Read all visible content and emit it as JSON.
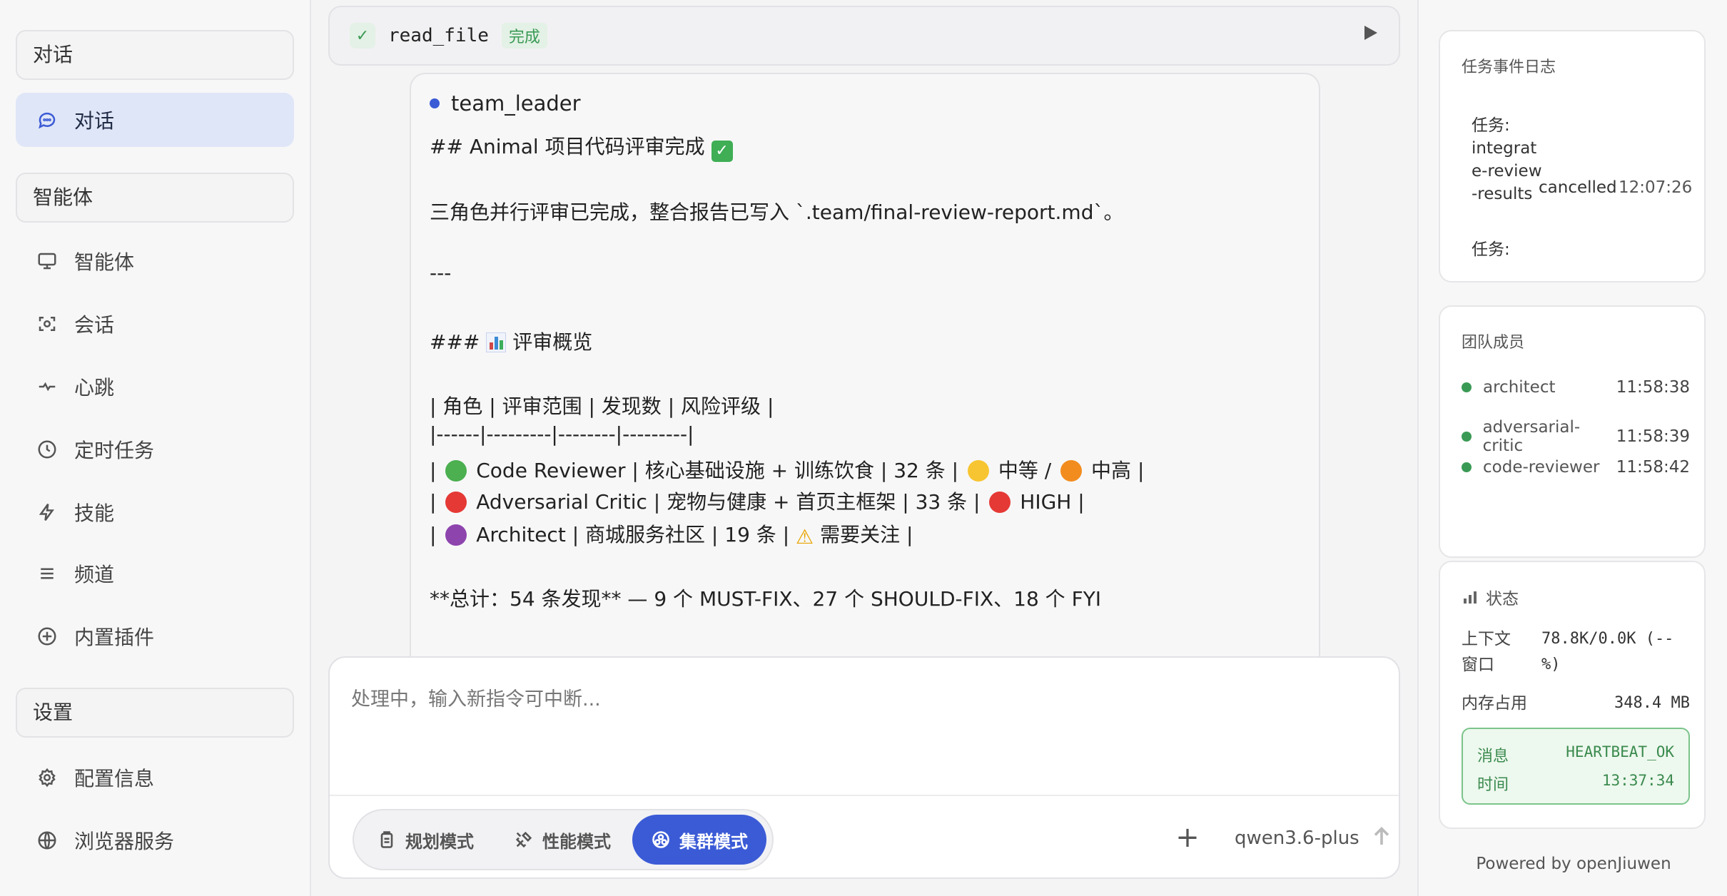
{
  "sidebar": {
    "section_chat": "对话",
    "item_chat": "对话",
    "section_agents": "智能体",
    "items": [
      {
        "label": "智能体",
        "icon": "monitor-icon"
      },
      {
        "label": "会话",
        "icon": "session-icon"
      },
      {
        "label": "心跳",
        "icon": "pulse-icon"
      },
      {
        "label": "定时任务",
        "icon": "clock-icon"
      },
      {
        "label": "技能",
        "icon": "bolt-icon"
      },
      {
        "label": "频道",
        "icon": "menu-icon"
      },
      {
        "label": "内置插件",
        "icon": "plus-circle-icon"
      }
    ],
    "section_settings": "设置",
    "settings_items": [
      {
        "label": "配置信息",
        "icon": "gear-icon"
      },
      {
        "label": "浏览器服务",
        "icon": "globe-icon"
      }
    ]
  },
  "main": {
    "tool": {
      "name": "read_file",
      "status": "完成"
    },
    "message": {
      "author": "team_leader",
      "lines": [
        "## Animal 项目代码评审完成",
        "三角色并行评审已完成，整合报告已写入 `.team/final-review-report.md`。",
        "---",
        "### ",
        "评审概览",
        "| 角色 | 评审范围 | 发现数 | 风险评级 |",
        "|------|---------|--------|---------|",
        "Code Reviewer | 核心基础设施 + 训练饮食 | 32 条 |",
        "中等 /",
        "中高 |",
        "Adversarial Critic | 宠物与健康 + 首页主框架 | 33 条 |",
        "HIGH |",
        "Architect | 商城服务社区 | 19 条 |",
        "需要关注 |",
        "**总计：54 条发现** — 9 个 MUST-FIX、27 个 SHOULD-FIX、18 个 FYI"
      ]
    },
    "composer": {
      "placeholder": "处理中，输入新指令可中断...",
      "modes": [
        "规划模式",
        "性能模式",
        "集群模式"
      ],
      "active_mode": "集群模式",
      "model": "qwen3.6-plus"
    }
  },
  "right": {
    "log": {
      "title": "任务事件日志",
      "entry1_label": "任务:",
      "entry1_name": "integrate-review-results",
      "entry1_status": "cancelled",
      "entry1_time": "12:07:26",
      "entry2_label": "任务:"
    },
    "team": {
      "title": "团队成员",
      "members": [
        {
          "name": "architect",
          "time": "11:58:38"
        },
        {
          "name": "adversarial-critic",
          "time": "11:58:39"
        },
        {
          "name": "code-reviewer",
          "time": "11:58:42"
        }
      ]
    },
    "status": {
      "title": "状态",
      "context_label": "上下文窗口",
      "context_value": "78.8K/0.0K (--%)",
      "memory_label": "内存占用",
      "memory_value": "348.4 MB",
      "heartbeat_msg_label": "消息",
      "heartbeat_msg_value": "HEARTBEAT_OK",
      "heartbeat_time_label": "时间",
      "heartbeat_time_value": "13:37:34"
    },
    "powered": "Powered by openJiuwen"
  },
  "colors": {
    "accent": "#3b5bd6",
    "success": "#3a9a55",
    "active_bg": "#dfe6f7"
  }
}
